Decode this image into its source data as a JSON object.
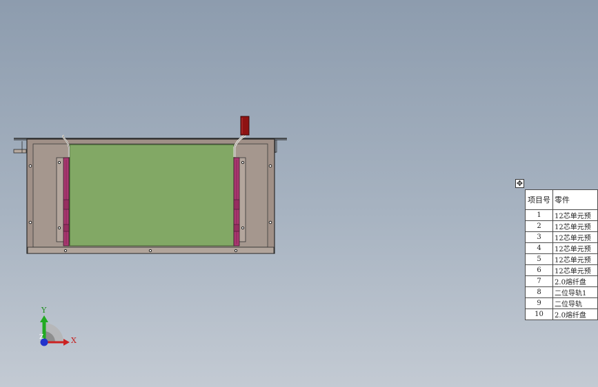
{
  "colors": {
    "background_top": "#8d9cae",
    "background_bottom": "#c3cad3",
    "enclosure": "#a09087",
    "board": "#82a865",
    "rail": "#a8386f",
    "connector": "#8e1212"
  },
  "axis_triad": {
    "x_label": "X",
    "y_label": "Y",
    "z_label": "Z"
  },
  "bom": {
    "move_handle_icon": "move-icon",
    "headers": {
      "item_no": "项目号",
      "part_no": "零件"
    },
    "rows": [
      {
        "no": "1",
        "name": "12芯单元预"
      },
      {
        "no": "2",
        "name": "12芯单元预"
      },
      {
        "no": "3",
        "name": "12芯单元预"
      },
      {
        "no": "4",
        "name": "12芯单元预"
      },
      {
        "no": "5",
        "name": "12芯单元预"
      },
      {
        "no": "6",
        "name": "12芯单元预"
      },
      {
        "no": "7",
        "name": "2.0熔纤盘"
      },
      {
        "no": "8",
        "name": "二位导轨1"
      },
      {
        "no": "9",
        "name": "二位导轨"
      },
      {
        "no": "10",
        "name": "2.0熔纤盘"
      }
    ]
  }
}
